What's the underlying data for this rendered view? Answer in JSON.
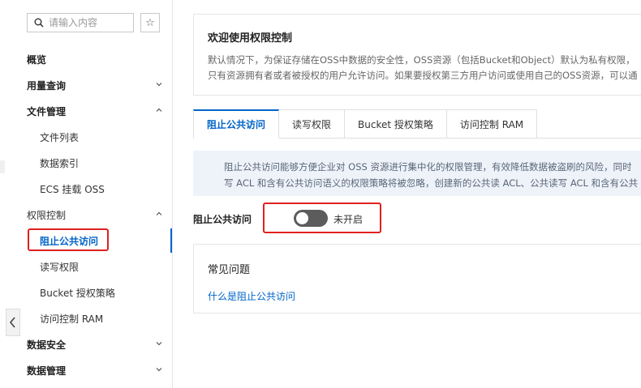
{
  "sidebar": {
    "search_placeholder": "请输入内容",
    "star_glyph": "☆",
    "items": [
      {
        "label": "概览",
        "level": "top"
      },
      {
        "label": "用量查询",
        "level": "top",
        "chevron": "down"
      },
      {
        "label": "文件管理",
        "level": "top",
        "chevron": "up"
      },
      {
        "label": "文件列表",
        "level": "sub"
      },
      {
        "label": "数据索引",
        "level": "sub"
      },
      {
        "label": "ECS 挂载 OSS",
        "level": "sub"
      },
      {
        "label": "权限控制",
        "level": "top",
        "chevron": "up"
      },
      {
        "label": "阻止公共访问",
        "level": "sub",
        "active": true
      },
      {
        "label": "读写权限",
        "level": "sub"
      },
      {
        "label": "Bucket 授权策略",
        "level": "sub"
      },
      {
        "label": "访问控制 RAM",
        "level": "sub"
      },
      {
        "label": "数据安全",
        "level": "top",
        "chevron": "down"
      },
      {
        "label": "数据管理",
        "level": "top",
        "chevron": "down"
      }
    ]
  },
  "welcome": {
    "title": "欢迎使用权限控制",
    "description": "默认情况下，为保证存储在OSS中数据的安全性，OSS资源（包括Bucket和Object）默认为私有权限，只有资源拥有者或者被授权的用户允许访问。如果要授权第三方用户访问或使用自己的OSS资源，可以通过多种不同的方式实现权限。"
  },
  "tabs": [
    {
      "label": "阻止公共访问",
      "active": true
    },
    {
      "label": "读写权限"
    },
    {
      "label": "Bucket 授权策略"
    },
    {
      "label": "访问控制 RAM"
    }
  ],
  "notice": {
    "line1": "阻止公共访问能够方便企业对 OSS 资源进行集中化的权限管理，有效降低数据被盗刷的风险，同时",
    "line2": "写 ACL 和含有公共访问语义的权限策略将被忽略，创建新的公共读 ACL、公共读写 ACL 和含有公共"
  },
  "block_public_access": {
    "label": "阻止公共访问",
    "enabled": false,
    "status_text": "未开启"
  },
  "faq": {
    "title": "常见问题",
    "link": "什么是阻止公共访问"
  },
  "colors": {
    "accent": "#0064c8",
    "highlight": "#e02020",
    "switch_off": "#5c5c5c"
  }
}
